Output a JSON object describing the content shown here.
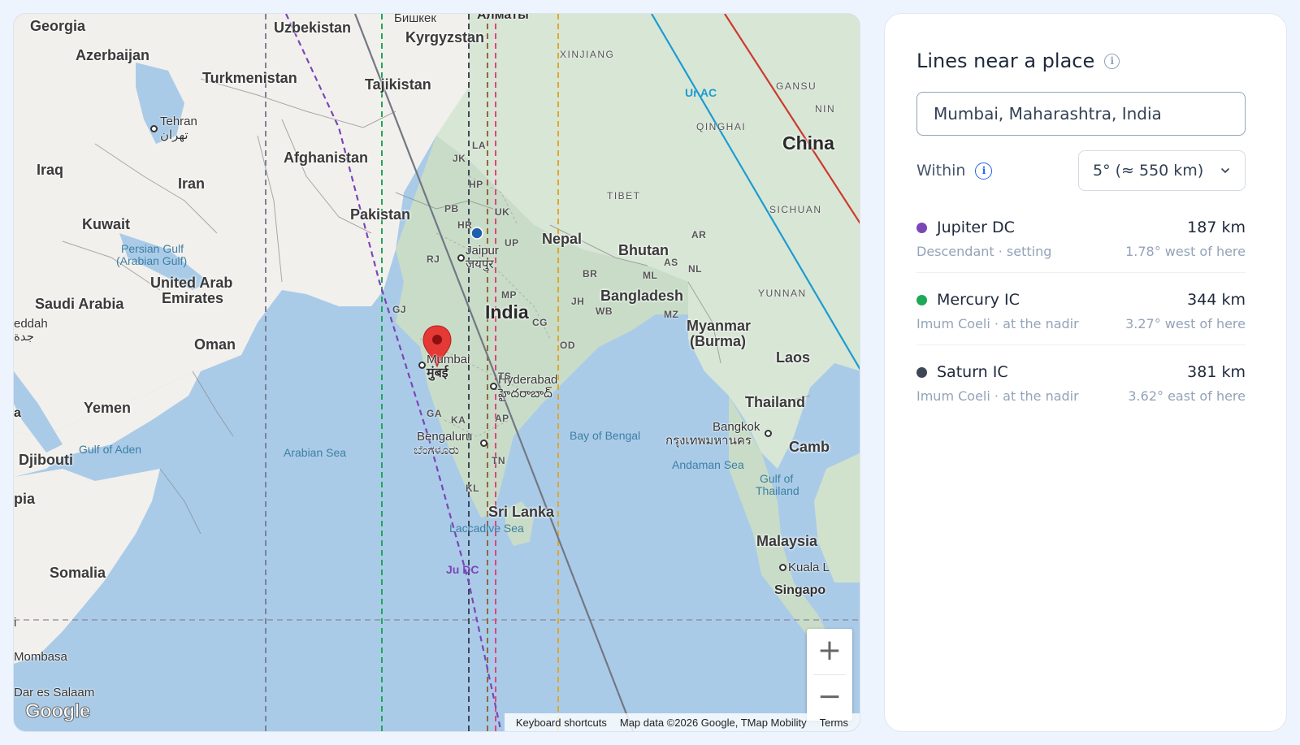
{
  "map": {
    "countries": [
      {
        "name": "Georgia"
      },
      {
        "name": "Azerbaijan"
      },
      {
        "name": "Uzbekistan"
      },
      {
        "name": "Kyrgyzstan"
      },
      {
        "name": "Turkmenistan"
      },
      {
        "name": "Tajikistan"
      },
      {
        "name": "Afghanistan"
      },
      {
        "name": "Iran"
      },
      {
        "name": "Iraq"
      },
      {
        "name": "Kuwait"
      },
      {
        "name": "Pakistan"
      },
      {
        "name": "Nepal"
      },
      {
        "name": "Bhutan"
      },
      {
        "name": "Bangladesh"
      },
      {
        "name": "Saudi Arabia"
      },
      {
        "name": "United Arab"
      },
      {
        "name": "Emirates"
      },
      {
        "name": "Oman"
      },
      {
        "name": "Yemen"
      },
      {
        "name": "Djibouti"
      },
      {
        "name": "Somalia"
      },
      {
        "name": "Sri Lanka"
      },
      {
        "name": "Myanmar"
      },
      {
        "name": "(Burma)"
      },
      {
        "name": "Laos"
      },
      {
        "name": "Thailand"
      },
      {
        "name": "Malaysia"
      },
      {
        "name": "Camb"
      },
      {
        "name": "pia"
      }
    ],
    "big_labels": {
      "india": "India",
      "china": "China"
    },
    "cities": {
      "tehran": "Tehran",
      "tehran_local": "تهران",
      "bishkek": "Бишкек",
      "almaty": "Алматы",
      "jaipur": "Jaipur",
      "jaipur_local": "जयपुर",
      "mumbai": "Mumbai",
      "mumbai_local": "मुंबई",
      "hyderabad": "Hyderabad",
      "hyderabad_local": "హైదరాబాద్",
      "bengaluru": "Bengaluru",
      "bengaluru_local": "ಬೆಂಗಳೂರು",
      "bangkok": "Bangkok",
      "bangkok_local": "กรุงเทพมหานคร",
      "kuala": "Kuala L",
      "singapore": "Singapo",
      "mombasa": "Mombasa",
      "dar": "Dar es Salaam",
      "jeddah": "eddah",
      "jeddah_local": "جدة",
      "a": "a",
      "i": "i"
    },
    "water": {
      "persian_gulf_1": "Persian Gulf",
      "persian_gulf_2": "(Arabian Gulf)",
      "arabian_sea": "Arabian Sea",
      "bay_of_bengal": "Bay of Bengal",
      "gulf_of_aden": "Gulf of Aden",
      "andaman": "Andaman Sea",
      "gulf_thailand_1": "Gulf of",
      "gulf_thailand_2": "Thailand",
      "laccadive": "Laccadive Sea"
    },
    "regions": {
      "xinjiang": "XINJIANG",
      "qinghai": "QINGHAI",
      "tibet": "TIBET",
      "sichuan": "SICHUAN",
      "yunnan": "YUNNAN",
      "gansu": "GANSU",
      "nin": "NIN"
    },
    "states": [
      "JK",
      "LA",
      "HP",
      "PB",
      "HR",
      "UK",
      "UP",
      "RJ",
      "GJ",
      "MP",
      "JH",
      "WB",
      "BR",
      "CG",
      "OD",
      "TS",
      "AP",
      "KA",
      "GA",
      "TN",
      "KL",
      "ML",
      "AS",
      "NL",
      "MZ",
      "AR"
    ],
    "line_labels": {
      "ju_dc": "Ju DC",
      "ur_ac": "Ur AC"
    },
    "line_colors": {
      "jupiter": "#7b46b8",
      "mercury": "#1ea858",
      "saturn": "#3f4655",
      "mars": "#cc3a2e",
      "uranus": "#1d9bd1",
      "venus": "#e0457b",
      "sun": "#e0a72b",
      "moon": "#7a8399",
      "pluto": "#8a6b3a"
    },
    "zoom_in": "+",
    "zoom_out": "−",
    "google_logo": "Google",
    "attribution": {
      "shortcuts": "Keyboard shortcuts",
      "data": "Map data ©2026 Google, TMap Mobility",
      "terms": "Terms"
    }
  },
  "panel": {
    "title": "Lines near a place",
    "place_value": "Mumbai, Maharashtra, India",
    "within_label": "Within",
    "within_value": "5° (≈ 550 km)",
    "lines": [
      {
        "name": "Jupiter DC",
        "color": "#7b46b8",
        "distance": "187 km",
        "desc": "Descendant · setting",
        "offset": "1.78° west of here"
      },
      {
        "name": "Mercury IC",
        "color": "#1ea858",
        "distance": "344 km",
        "desc": "Imum Coeli · at the nadir",
        "offset": "3.27° west of here"
      },
      {
        "name": "Saturn IC",
        "color": "#3f4655",
        "distance": "381 km",
        "desc": "Imum Coeli · at the nadir",
        "offset": "3.62° east of here"
      }
    ]
  }
}
